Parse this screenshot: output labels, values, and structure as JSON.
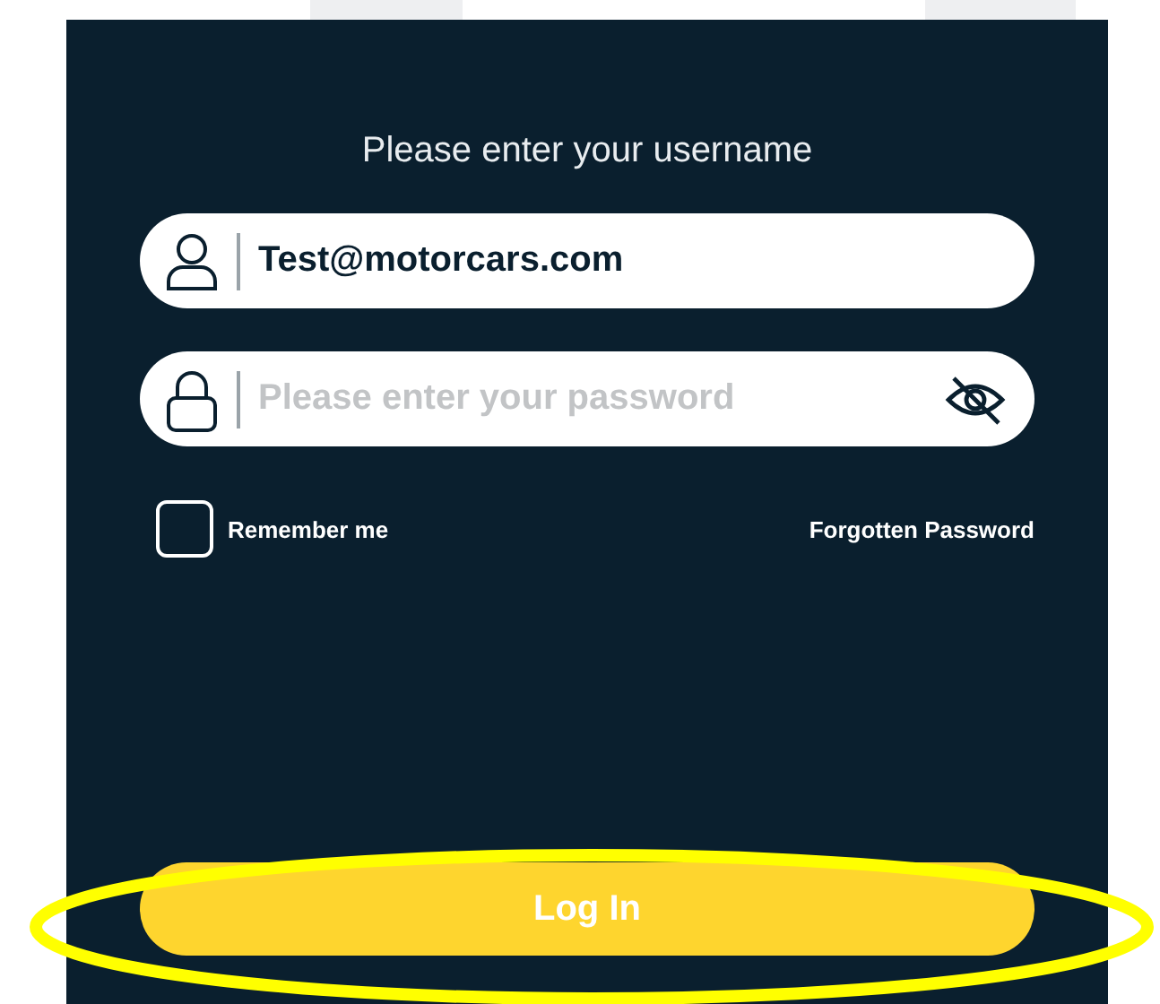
{
  "heading": "Please enter your username",
  "username": {
    "value": "Test@motorcars.com"
  },
  "password": {
    "placeholder": "Please enter your password"
  },
  "remember_me": {
    "label": "Remember me",
    "checked": false
  },
  "forgot_link": "Forgotten Password",
  "login_button": "Log In",
  "annotation": {
    "kind": "ellipse",
    "color": "#ffff00"
  }
}
